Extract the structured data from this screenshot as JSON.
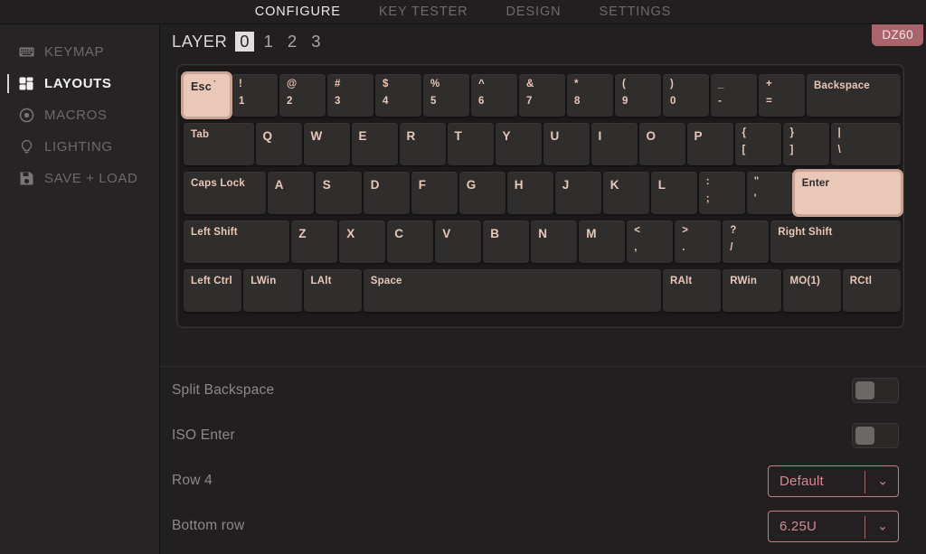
{
  "topnav": {
    "tabs": [
      {
        "label": "CONFIGURE",
        "active": true
      },
      {
        "label": "KEY TESTER",
        "active": false
      },
      {
        "label": "DESIGN",
        "active": false
      },
      {
        "label": "SETTINGS",
        "active": false
      }
    ]
  },
  "sidebar": {
    "items": [
      {
        "label": "KEYMAP",
        "icon": "keyboard-icon",
        "active": false
      },
      {
        "label": "LAYOUTS",
        "icon": "layout-grid-icon",
        "active": true
      },
      {
        "label": "MACROS",
        "icon": "record-dot-icon",
        "active": false
      },
      {
        "label": "LIGHTING",
        "icon": "lightbulb-icon",
        "active": false
      },
      {
        "label": "SAVE + LOAD",
        "icon": "floppy-disk-icon",
        "active": false
      }
    ]
  },
  "layer_selector": {
    "word": "LAYER",
    "layers": [
      "0",
      "1",
      "2",
      "3"
    ],
    "active": "0"
  },
  "device_badge": {
    "label": "DZ60",
    "color": "#a9646c"
  },
  "keyboard": {
    "unit": 53,
    "rows": [
      {
        "keys": [
          {
            "label": "Esc",
            "tick": "`",
            "w": 1,
            "state": "selected"
          },
          {
            "label": "!",
            "sub": "1",
            "w": 1
          },
          {
            "label": "@",
            "sub": "2",
            "w": 1
          },
          {
            "label": "#",
            "sub": "3",
            "w": 1
          },
          {
            "label": "$",
            "sub": "4",
            "w": 1
          },
          {
            "label": "%",
            "sub": "5",
            "w": 1
          },
          {
            "label": "^",
            "sub": "6",
            "w": 1
          },
          {
            "label": "&",
            "sub": "7",
            "w": 1
          },
          {
            "label": "*",
            "sub": "8",
            "w": 1
          },
          {
            "label": "(",
            "sub": "9",
            "w": 1
          },
          {
            "label": ")",
            "sub": "0",
            "w": 1
          },
          {
            "label": "_",
            "sub": "-",
            "w": 1
          },
          {
            "label": "+",
            "sub": "=",
            "w": 1
          },
          {
            "label": "Backspace",
            "w": 2
          }
        ]
      },
      {
        "keys": [
          {
            "label": "Tab",
            "w": 1.5
          },
          {
            "label": "Q",
            "w": 1,
            "big": true
          },
          {
            "label": "W",
            "w": 1,
            "big": true
          },
          {
            "label": "E",
            "w": 1,
            "big": true
          },
          {
            "label": "R",
            "w": 1,
            "big": true
          },
          {
            "label": "T",
            "w": 1,
            "big": true
          },
          {
            "label": "Y",
            "w": 1,
            "big": true
          },
          {
            "label": "U",
            "w": 1,
            "big": true
          },
          {
            "label": "I",
            "w": 1,
            "big": true
          },
          {
            "label": "O",
            "w": 1,
            "big": true
          },
          {
            "label": "P",
            "w": 1,
            "big": true
          },
          {
            "label": "{",
            "sub": "[",
            "w": 1
          },
          {
            "label": "}",
            "sub": "]",
            "w": 1
          },
          {
            "label": "|",
            "sub": "\\",
            "w": 1.5
          }
        ]
      },
      {
        "keys": [
          {
            "label": "Caps Lock",
            "w": 1.75
          },
          {
            "label": "A",
            "w": 1,
            "big": true
          },
          {
            "label": "S",
            "w": 1,
            "big": true
          },
          {
            "label": "D",
            "w": 1,
            "big": true
          },
          {
            "label": "F",
            "w": 1,
            "big": true
          },
          {
            "label": "G",
            "w": 1,
            "big": true
          },
          {
            "label": "H",
            "w": 1,
            "big": true
          },
          {
            "label": "J",
            "w": 1,
            "big": true
          },
          {
            "label": "K",
            "w": 1,
            "big": true
          },
          {
            "label": "L",
            "w": 1,
            "big": true
          },
          {
            "label": ":",
            "sub": ";",
            "w": 1
          },
          {
            "label": "\"",
            "sub": "'",
            "w": 1
          },
          {
            "label": "Enter",
            "w": 2.25,
            "state": "hovered"
          }
        ]
      },
      {
        "keys": [
          {
            "label": "Left Shift",
            "w": 2.25
          },
          {
            "label": "Z",
            "w": 1,
            "big": true
          },
          {
            "label": "X",
            "w": 1,
            "big": true
          },
          {
            "label": "C",
            "w": 1,
            "big": true
          },
          {
            "label": "V",
            "w": 1,
            "big": true
          },
          {
            "label": "B",
            "w": 1,
            "big": true
          },
          {
            "label": "N",
            "w": 1,
            "big": true
          },
          {
            "label": "M",
            "w": 1,
            "big": true
          },
          {
            "label": "<",
            "sub": ",",
            "w": 1
          },
          {
            "label": ">",
            "sub": ".",
            "w": 1
          },
          {
            "label": "?",
            "sub": "/",
            "w": 1
          },
          {
            "label": "Right Shift",
            "w": 2.75
          }
        ]
      },
      {
        "keys": [
          {
            "label": "Left Ctrl",
            "w": 1.25
          },
          {
            "label": "LWin",
            "w": 1.25
          },
          {
            "label": "LAlt",
            "w": 1.25
          },
          {
            "label": "Space",
            "w": 6.25
          },
          {
            "label": "RAlt",
            "w": 1.25
          },
          {
            "label": "RWin",
            "w": 1.25
          },
          {
            "label": "MO(1)",
            "w": 1.25
          },
          {
            "label": "RCtl",
            "w": 1.25
          }
        ]
      }
    ]
  },
  "options": [
    {
      "label": "Split Backspace",
      "type": "toggle",
      "value": "off"
    },
    {
      "label": "ISO Enter",
      "type": "toggle",
      "value": "off"
    },
    {
      "label": "Row 4",
      "type": "select",
      "value": "Default"
    },
    {
      "label": "Bottom row",
      "type": "select",
      "value": "6.25U"
    }
  ]
}
